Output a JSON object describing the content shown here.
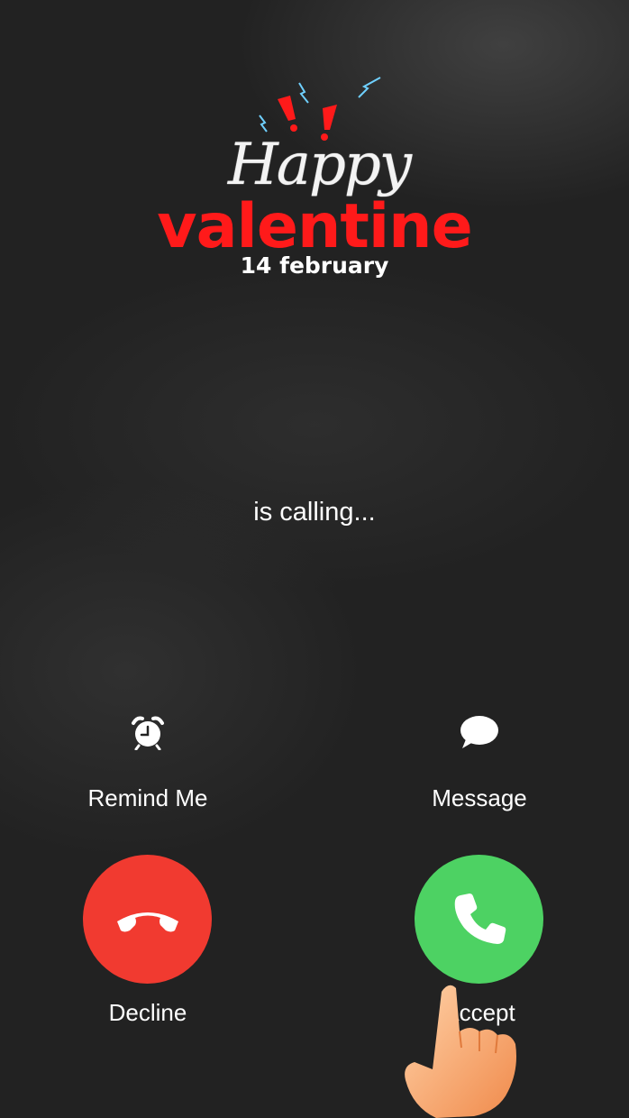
{
  "banner": {
    "happy": "Happy",
    "title": "valentine",
    "date": "14 february"
  },
  "call": {
    "status": "is calling..."
  },
  "options": {
    "remind_label": "Remind Me",
    "message_label": "Message"
  },
  "actions": {
    "decline_label": "Decline",
    "accept_label": "Accept"
  },
  "colors": {
    "title": "#ff1a1a",
    "decline": "#f13a30",
    "accept": "#4dd263"
  },
  "icons": [
    "alarm-clock-icon",
    "speech-bubble-icon",
    "phone-hangup-icon",
    "phone-icon",
    "pointing-hand-icon",
    "exclamation-icon"
  ]
}
